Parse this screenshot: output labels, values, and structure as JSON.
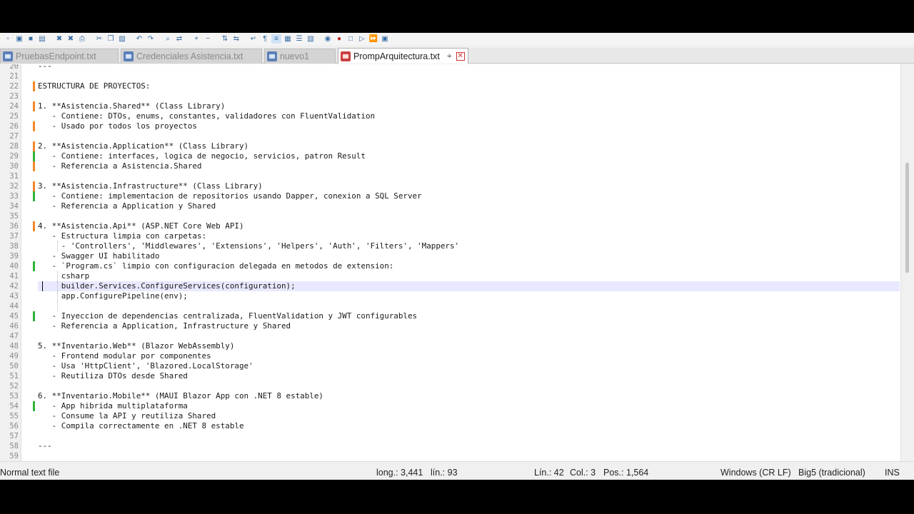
{
  "toolbar": {
    "icons": [
      "new-file-icon",
      "open-file-icon",
      "save-icon",
      "save-all-icon",
      "close-icon",
      "close-all-icon",
      "print-icon",
      "cut-icon",
      "copy-icon",
      "paste-icon",
      "undo-icon",
      "redo-icon",
      "find-icon",
      "replace-icon",
      "zoom-in-icon",
      "zoom-out-icon",
      "sync-vertical-icon",
      "sync-horizontal-icon",
      "word-wrap-icon",
      "show-all-chars-icon",
      "indent-guide-icon",
      "doc-map-icon",
      "function-list-icon",
      "folder-workspace-icon",
      "monitoring-icon",
      "record-macro-icon",
      "stop-record-icon",
      "play-macro-icon",
      "run-macro-multiple-icon",
      "save-macro-icon"
    ]
  },
  "tabs": [
    {
      "label": "PruebasEndpoint.txt",
      "active": false
    },
    {
      "label": "Credenciales Asistencia.txt",
      "active": false
    },
    {
      "label": "nuevo1",
      "active": false
    },
    {
      "label": "PrompArquitectura.txt",
      "active": true
    }
  ],
  "editor": {
    "first_line": 20,
    "current_line": 42,
    "lines": [
      {
        "n": "20",
        "text": "---"
      },
      {
        "n": "21",
        "text": ""
      },
      {
        "n": "22",
        "text": "ESTRUCTURA DE PROYECTOS:",
        "mark": "orange"
      },
      {
        "n": "23",
        "text": ""
      },
      {
        "n": "24",
        "text": "1. **Asistencia.Shared** (Class Library)",
        "mark": "orange"
      },
      {
        "n": "25",
        "text": "   - Contiene: DTOs, enums, constantes, validadores con FluentValidation"
      },
      {
        "n": "26",
        "text": "   - Usado por todos los proyectos",
        "mark": "orange"
      },
      {
        "n": "27",
        "text": ""
      },
      {
        "n": "28",
        "text": "2. **Asistencia.Application** (Class Library)",
        "mark": "orange"
      },
      {
        "n": "29",
        "text": "   - Contiene: interfaces, logica de negocio, servicios, patron Result",
        "mark": "green"
      },
      {
        "n": "30",
        "text": "   - Referencia a Asistencia.Shared",
        "mark": "orange"
      },
      {
        "n": "31",
        "text": ""
      },
      {
        "n": "32",
        "text": "3. **Asistencia.Infrastructure** (Class Library)",
        "mark": "orange"
      },
      {
        "n": "33",
        "text": "   - Contiene: implementacion de repositorios usando Dapper, conexion a SQL Server",
        "mark": "green"
      },
      {
        "n": "34",
        "text": "   - Referencia a Application y Shared"
      },
      {
        "n": "35",
        "text": ""
      },
      {
        "n": "36",
        "text": "4. **Asistencia.Api** (ASP.NET Core Web API)",
        "mark": "orange"
      },
      {
        "n": "37",
        "text": "   - Estructura limpia con carpetas:"
      },
      {
        "n": "38",
        "text": "     - 'Controllers', 'Middlewares', 'Extensions', 'Helpers', 'Auth', 'Filters', 'Mappers'",
        "guide": true
      },
      {
        "n": "39",
        "text": "   - Swagger UI habilitado"
      },
      {
        "n": "40",
        "text": "   - `Program.cs` limpio con configuracion delegada en metodos de extension:",
        "mark": "green"
      },
      {
        "n": "41",
        "text": "     csharp",
        "guide": true
      },
      {
        "n": "42",
        "text": "     builder.Services.ConfigureServices(configuration);",
        "guide": true
      },
      {
        "n": "43",
        "text": "     app.ConfigurePipeline(env);",
        "guide": true
      },
      {
        "n": "44",
        "text": "",
        "guide": true
      },
      {
        "n": "45",
        "text": "   - Inyeccion de dependencias centralizada, FluentValidation y JWT configurables",
        "mark": "green"
      },
      {
        "n": "46",
        "text": "   - Referencia a Application, Infrastructure y Shared"
      },
      {
        "n": "47",
        "text": ""
      },
      {
        "n": "48",
        "text": "5. **Inventario.Web** (Blazor WebAssembly)"
      },
      {
        "n": "49",
        "text": "   - Frontend modular por componentes"
      },
      {
        "n": "50",
        "text": "   - Usa 'HttpClient', 'Blazored.LocalStorage'"
      },
      {
        "n": "51",
        "text": "   - Reutiliza DTOs desde Shared"
      },
      {
        "n": "52",
        "text": ""
      },
      {
        "n": "53",
        "text": "6. **Inventario.Mobile** (MAUI Blazor App con .NET 8 estable)"
      },
      {
        "n": "54",
        "text": "   - App hibrida multiplataforma",
        "mark": "green"
      },
      {
        "n": "55",
        "text": "   - Consume la API y reutiliza Shared"
      },
      {
        "n": "56",
        "text": "   - Compila correctamente en .NET 8 estable"
      },
      {
        "n": "57",
        "text": ""
      },
      {
        "n": "58",
        "text": "---"
      },
      {
        "n": "59",
        "text": ""
      }
    ]
  },
  "status": {
    "file_type": "Normal text file",
    "length": "long.: 3,441",
    "lines": "lín.: 93",
    "line_pos": "Lín.: 42",
    "col": "Col.: 3",
    "pos": "Pos.: 1,564",
    "eol": "Windows (CR LF)",
    "encoding": "Big5 (tradicional)",
    "mode": "INS"
  },
  "colors": {
    "orange_mark": "#f0882a",
    "green_mark": "#2fb33a",
    "current_line": "#e8e8ff"
  }
}
